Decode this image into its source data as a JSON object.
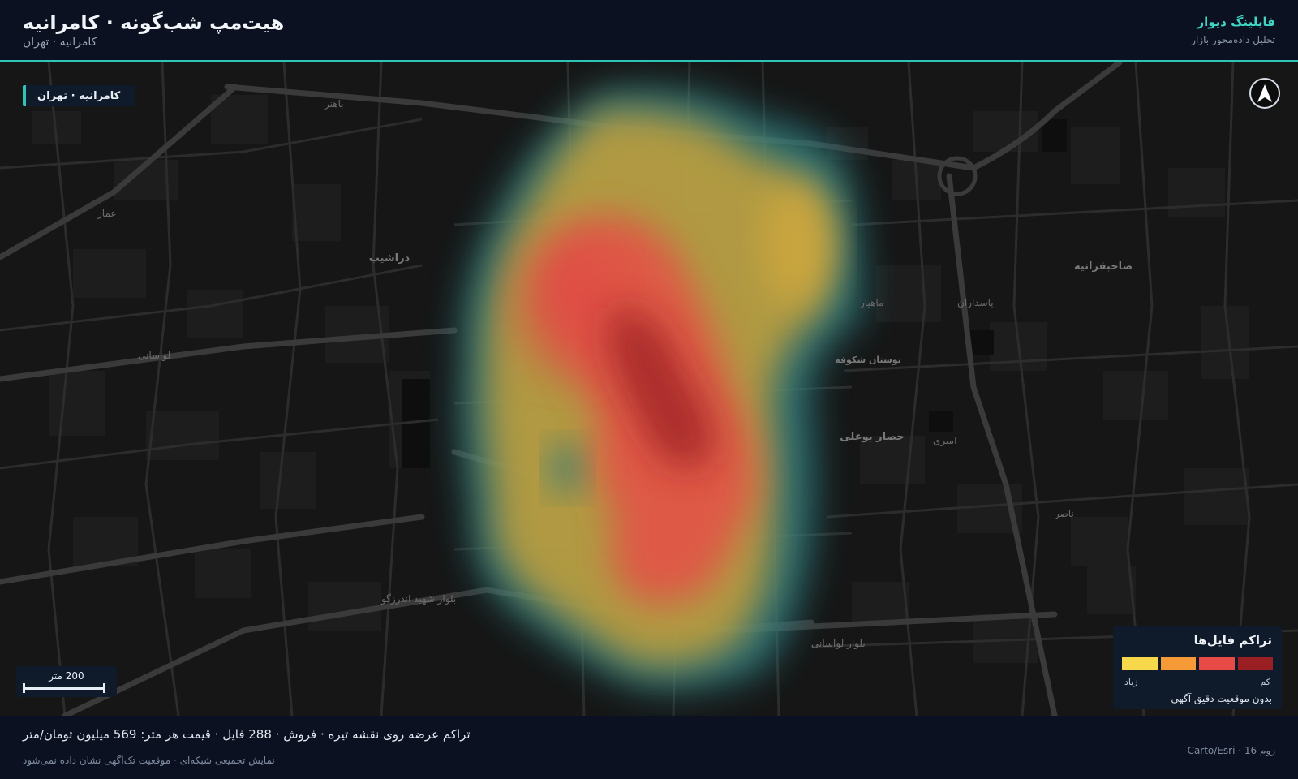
{
  "header": {
    "title": "هیت‌مپ شب‌گونه · کامرانیه",
    "subtitle": "کامرانیه · تهران",
    "brand_name": "فایلینگ دیوار",
    "brand_tagline": "تحلیل داده‌محور بازار"
  },
  "map": {
    "location_chip": "کامرانیه · تهران",
    "compass_icon": "north-arrow-icon",
    "scale_label": "200 متر",
    "district_labels": [
      "دراشیب",
      "صاحبقرانیه",
      "حصار بوعلی",
      "بوستان شکوفه"
    ],
    "street_labels": [
      "باهنر",
      "بلوار شهید اندرزگو",
      "بلوار لواسانی",
      "لواسانی",
      "امیری",
      "عمار",
      "ناصر",
      "ماهیار",
      "پاسداران"
    ],
    "heatmap": {
      "colors": {
        "low": "#f6d84a",
        "mid_low": "#f59a36",
        "mid_high": "#e84a45",
        "high": "#9a1f22",
        "edge": "#3a8a8a"
      }
    }
  },
  "legend": {
    "title": "تراکم فایل‌ها",
    "low_label": "کم",
    "high_label": "زیاد",
    "note": "بدون موقعیت دقیق آگهی",
    "swatches": [
      "#f6d84a",
      "#f59a36",
      "#e84a45",
      "#9a1f22"
    ]
  },
  "footer": {
    "stats": "تراکم عرضه روی نقشه تیره · فروش · 288 فایل · قیمت هر متر: 569 میلیون تومان/متر",
    "note": "نمایش تجمیعی شبکه‌ای · موقعیت تک‌آگهی نشان داده نمی‌شود",
    "source": "زوم 16 · Carto/Esri"
  }
}
